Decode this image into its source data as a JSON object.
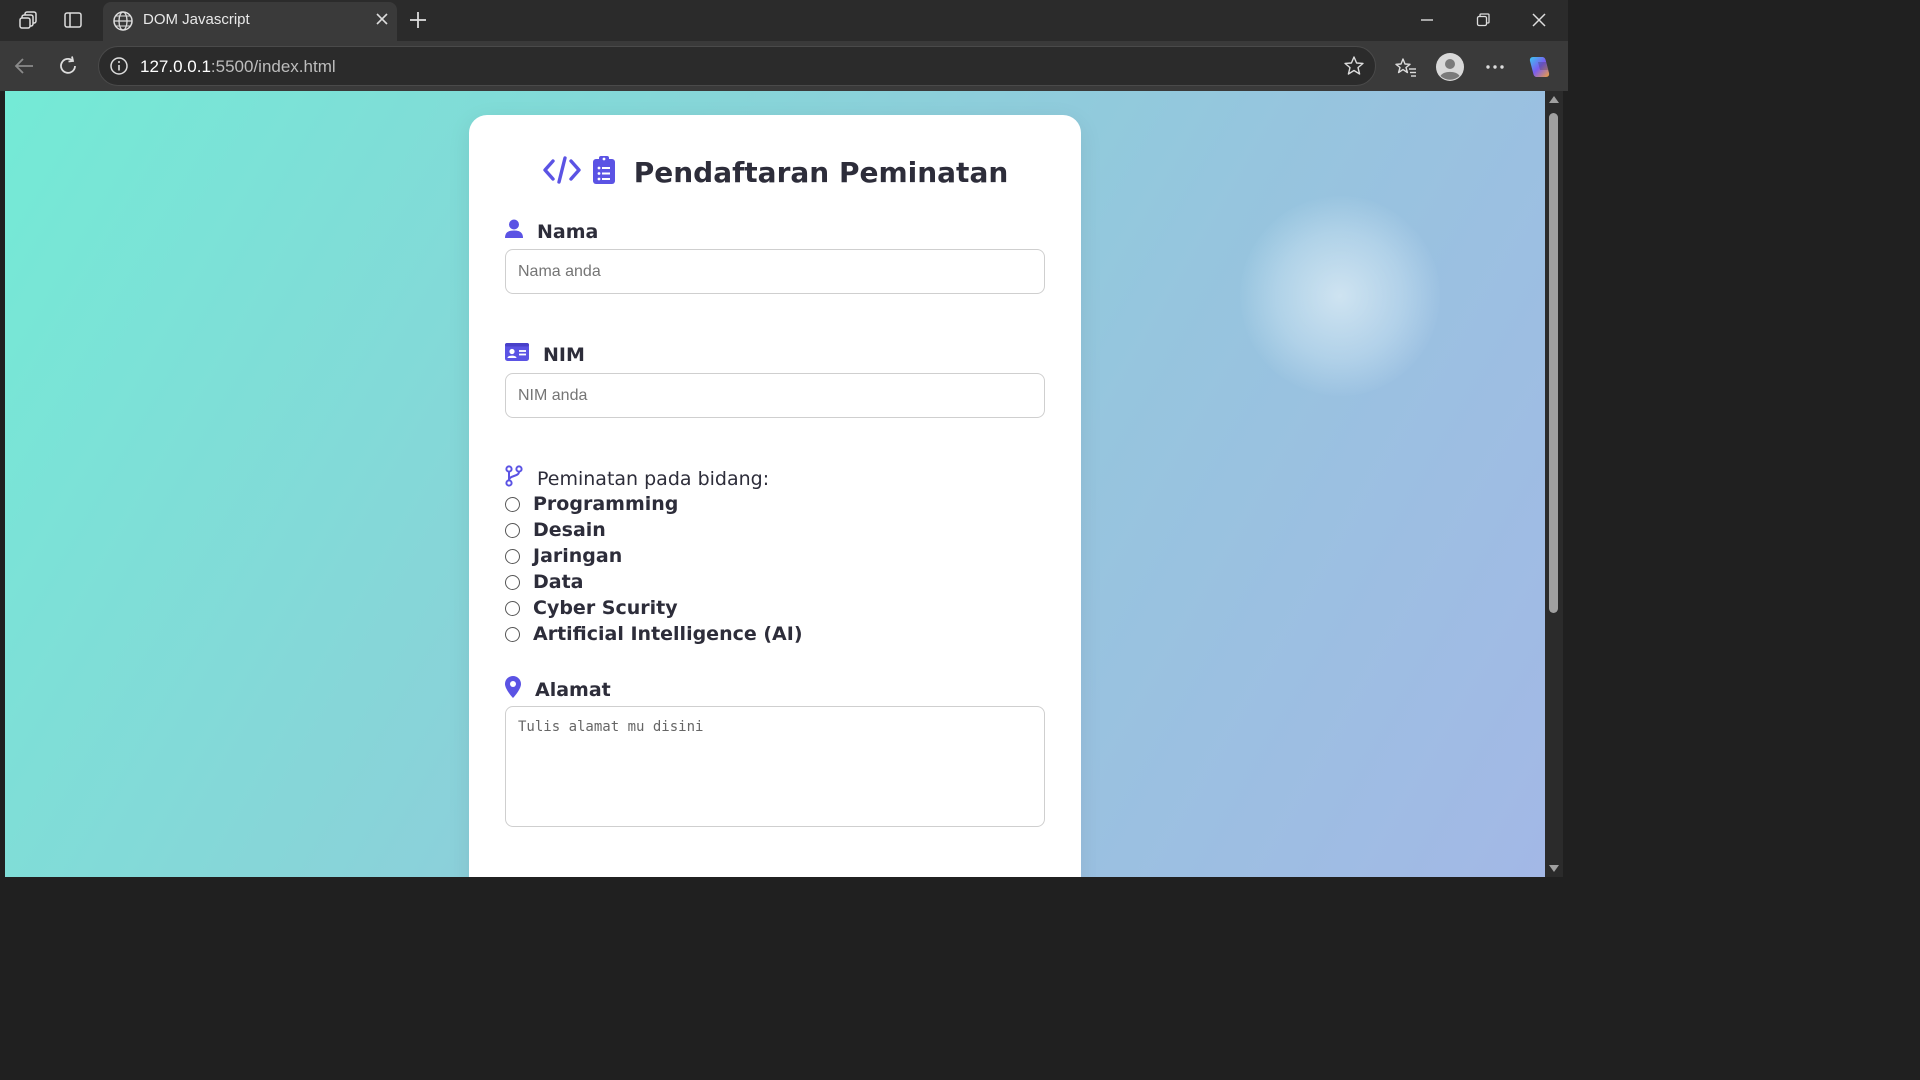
{
  "browser": {
    "tab_title": "DOM Javascript",
    "url_host": "127.0.0.1",
    "url_rest": ":5500/index.html"
  },
  "form": {
    "title": "Pendaftaran Peminatan",
    "nama": {
      "label": "Nama",
      "placeholder": "Nama anda"
    },
    "nim": {
      "label": "NIM",
      "placeholder": "NIM anda"
    },
    "interest": {
      "label": "Peminatan pada bidang:",
      "options": [
        "Programming",
        "Desain",
        "Jaringan",
        "Data",
        "Cyber Scurity",
        "Artificial Intelligence (AI)"
      ]
    },
    "alamat": {
      "label": "Alamat",
      "placeholder": "Tulis alamat mu disini"
    }
  },
  "colors": {
    "accent": "#5b53e4",
    "bg_start": "#74ead6",
    "bg_end": "#a3b8e6"
  }
}
